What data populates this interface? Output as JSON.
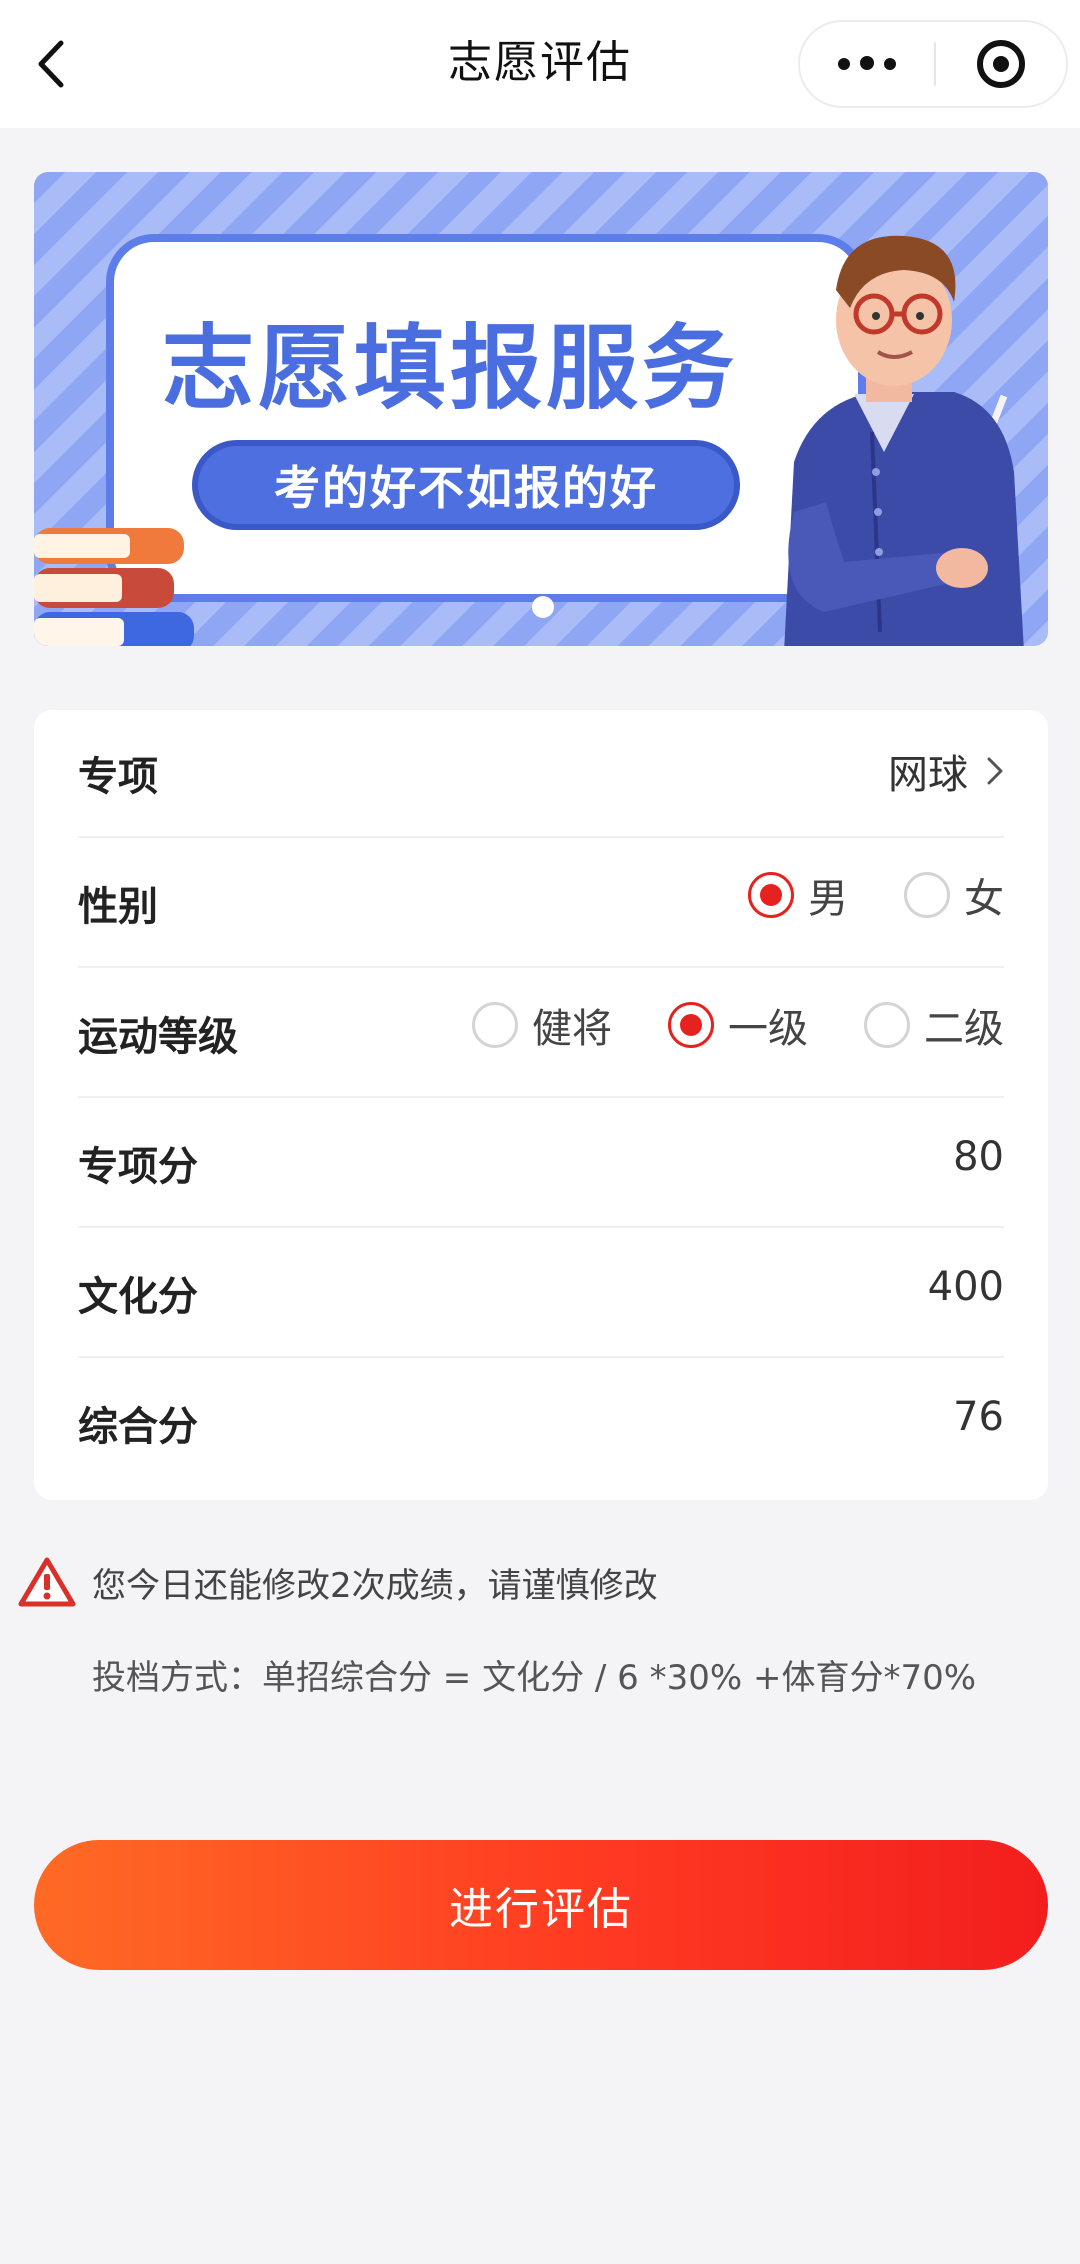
{
  "navbar": {
    "title": "志愿评估",
    "back_icon": "chevron-left-icon",
    "more_icon": "more-dots-icon",
    "close_icon": "target-close-icon"
  },
  "banner": {
    "title": "志愿填报服务",
    "slogan": "考的好不如报的好",
    "active_slide": 1,
    "slide_count": 1
  },
  "form": {
    "specialty": {
      "label": "专项",
      "value": "网球"
    },
    "gender": {
      "label": "性别",
      "options": [
        {
          "label": "男",
          "selected": true
        },
        {
          "label": "女",
          "selected": false
        }
      ]
    },
    "level": {
      "label": "运动等级",
      "options": [
        {
          "label": "健将",
          "selected": false
        },
        {
          "label": "一级",
          "selected": true
        },
        {
          "label": "二级",
          "selected": false
        }
      ]
    },
    "specialty_score": {
      "label": "专项分",
      "value": "80"
    },
    "culture_score": {
      "label": "文化分",
      "value": "400"
    },
    "total_score": {
      "label": "综合分",
      "value": "76"
    }
  },
  "notice": {
    "icon": "warning-triangle-icon",
    "text": "您今日还能修改2次成绩，请谨慎修改",
    "formula": "投档方式：单招综合分 = 文化分 / 6 *30% +体育分*70%"
  },
  "submit": {
    "label": "进行评估"
  },
  "colors": {
    "accent": "#e5221f",
    "button_start": "#ff6a24",
    "button_end": "#f21e1e",
    "banner_blue": "#4a6ee0"
  }
}
